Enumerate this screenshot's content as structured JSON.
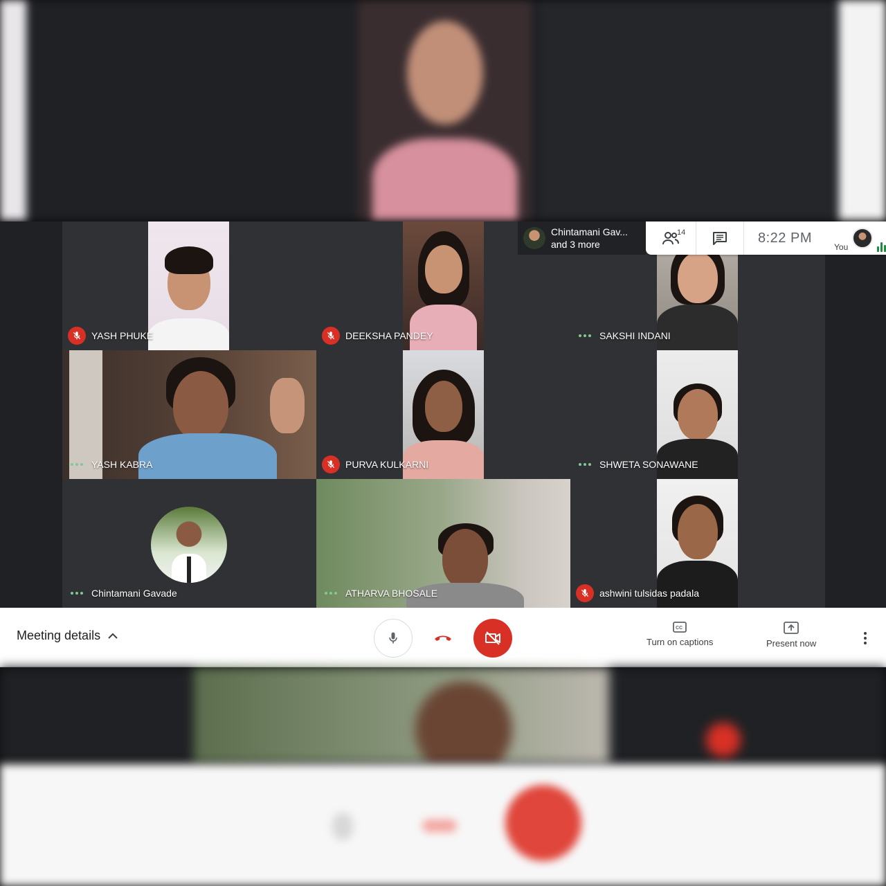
{
  "participants_header": {
    "chip_name": "Chintamani Gav...",
    "chip_more": "and 3 more",
    "people_count": "14",
    "time": "8:22 PM",
    "you_label": "You"
  },
  "tiles": [
    {
      "name": "YASH PHUKE",
      "muted": true
    },
    {
      "name": "DEEKSHA PANDEY",
      "muted": true
    },
    {
      "name": "SAKSHI INDANI",
      "muted": false
    },
    {
      "name": "YASH KABRA",
      "muted": false
    },
    {
      "name": "PURVA KULKARNI",
      "muted": true
    },
    {
      "name": "SHWETA SONAWANE",
      "muted": false
    },
    {
      "name": "Chintamani Gavade",
      "muted": false
    },
    {
      "name": "ATHARVA BHOSALE",
      "muted": false
    },
    {
      "name": "ashwini tulsidas padala",
      "muted": true
    }
  ],
  "controls": {
    "meeting_details": "Meeting details",
    "captions": "Turn on captions",
    "present": "Present now"
  },
  "colors": {
    "accent_red": "#d93025",
    "tile_bg": "#303134",
    "stage_bg": "#202124"
  }
}
